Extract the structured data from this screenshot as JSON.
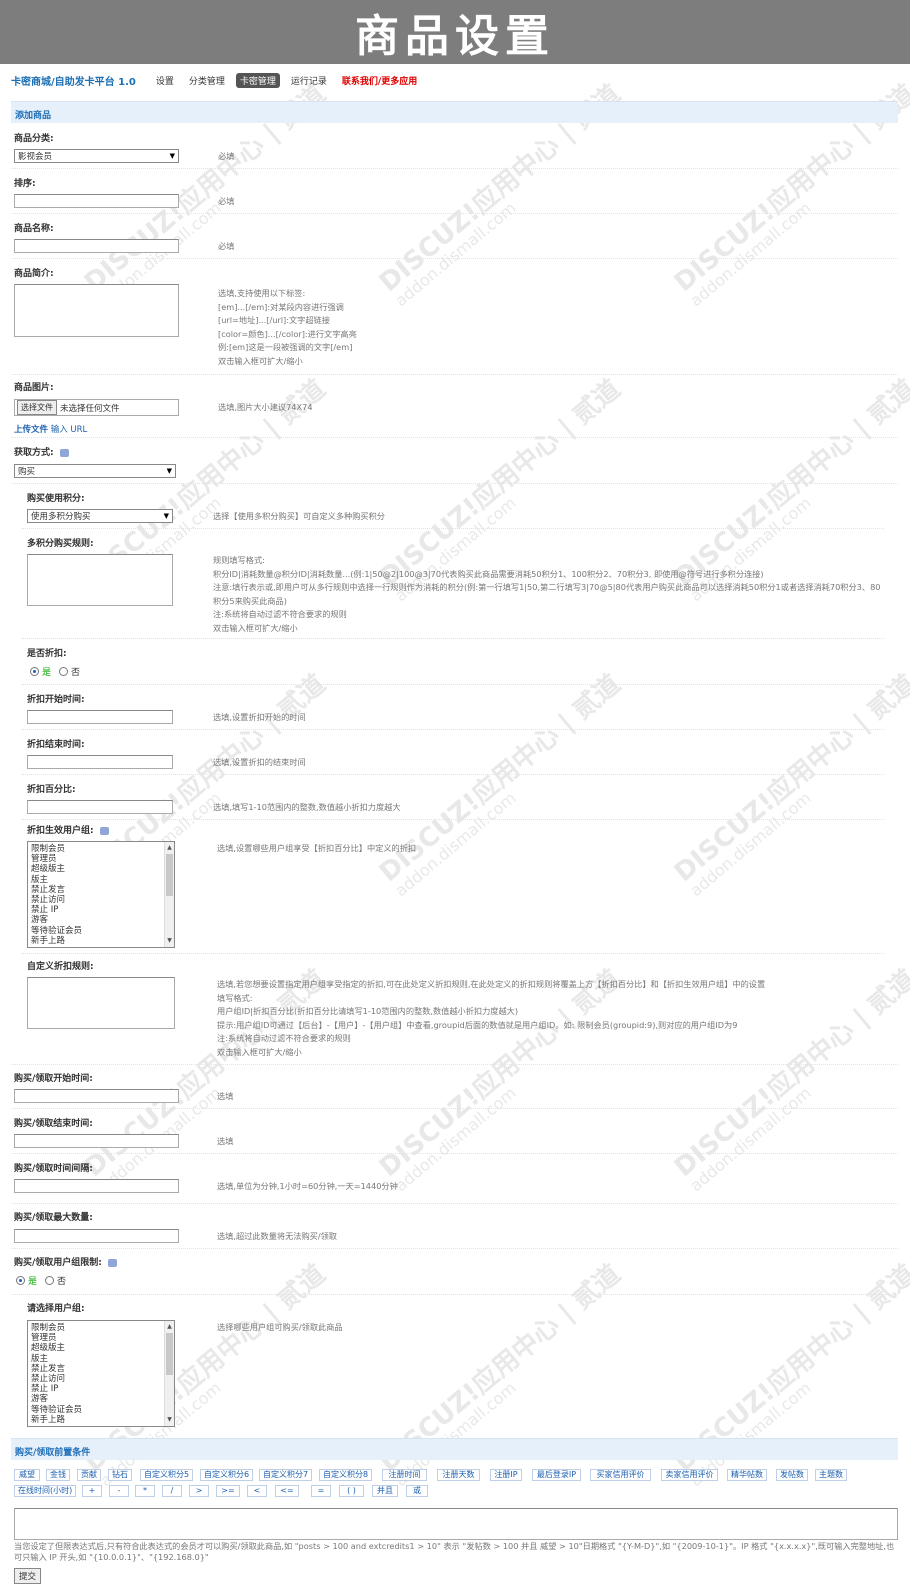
{
  "banner": {
    "title": "商品设置"
  },
  "topnav": {
    "brand": "卡密商城/自助发卡平台 1.0",
    "items": [
      "设置",
      "分类管理",
      "卡密管理",
      "运行记录",
      "联系我们/更多应用"
    ]
  },
  "watermark": {
    "brand": "DISCUZ!应用中心 | 贰道",
    "url": "addon.dismall.com"
  },
  "section_add": "添加商品",
  "category": {
    "label": "商品分类:",
    "value": "影视会员",
    "hint": "必填"
  },
  "sort": {
    "label": "排序:",
    "hint": "必填"
  },
  "name": {
    "label": "商品名称:",
    "hint": "必填"
  },
  "intro": {
    "label": "商品简介:",
    "hints": [
      "选填,支持使用以下标签:",
      "[em]...[/em]:对某段内容进行强调",
      "[url=地址]...[/url]:文字超链接",
      "[color=颜色]...[/color]:进行文字高亮",
      "例:[em]这是一段被强调的文字[/em]",
      "双击输入框可扩大/缩小"
    ]
  },
  "image": {
    "label": "商品图片:",
    "file_button": "选择文件",
    "file_status": "未选择任何文件",
    "upload_link": "上传文件",
    "input_link": "输入 URL",
    "hint": "选填,图片大小建议74X74"
  },
  "acquire": {
    "label": "获取方式:",
    "value": "购买"
  },
  "points": {
    "label": "购买使用积分:",
    "value": "使用多积分购买",
    "hint": "选择【使用多积分购买】可自定义多种购买积分"
  },
  "multi_points": {
    "label": "多积分购买规则:",
    "hints": [
      "规则填写格式:",
      "积分ID|消耗数量@积分ID|消耗数量...(例:1|50@2|100@3|70代表购买此商品需要消耗50积分1、100积分2、70积分3, 即使用@符号进行多积分连接)",
      "注意:填行表示或,即用户可从多行规则中选择一行规则作为消耗的积分(例:第一行填写1|50,第二行填写3|70@5|80代表用户购买此商品可以选择消耗50积分1或者选择消耗70积分3、80积分5来购买此商品)",
      "注:系统将自动过滤不符合要求的规则",
      "双击输入框可扩大/缩小"
    ]
  },
  "discount": {
    "label": "是否折扣:",
    "yes": "是",
    "no": "否"
  },
  "discount_start": {
    "label": "折扣开始时间:",
    "hint": "选填,设置折扣开始的时间"
  },
  "discount_end": {
    "label": "折扣结束时间:",
    "hint": "选填,设置折扣的结束时间"
  },
  "discount_percent": {
    "label": "折扣百分比:",
    "hint": "选填,填写1-10范围内的整数,数值越小折扣力度越大"
  },
  "discount_groups": {
    "label": "折扣生效用户组:",
    "hint": "选填,设置哪些用户组享受【折扣百分比】中定义的折扣"
  },
  "usergroups": [
    "限制会员",
    "管理员",
    "超级版主",
    "版主",
    "禁止发言",
    "禁止访问",
    "禁止 IP",
    "游客",
    "等待验证会员",
    "新手上路"
  ],
  "custom_discount": {
    "label": "自定义折扣规则:",
    "hints": [
      "选填,若您想要设置指定用户组享受指定的折扣,可在此处定义折扣规则,在此处定义的折扣规则将覆盖上方【折扣百分比】和【折扣生效用户组】中的设置",
      "填写格式:",
      "用户组ID|折扣百分比(折扣百分比请填写1-10范围内的整数,数值越小折扣力度越大)",
      "提示:用户组ID可通过【后台】-【用户】-【用户组】中查看,groupid后面的数值就是用户组ID。如: 限制会员(groupid:9),则对应的用户组ID为9",
      "注:系统将自动过滤不符合要求的规则",
      "双击输入框可扩大/缩小"
    ]
  },
  "buy_start": {
    "label": "购买/领取开始时间:",
    "hint": "选填"
  },
  "buy_end": {
    "label": "购买/领取结束时间:",
    "hint": "选填"
  },
  "buy_interval": {
    "label": "购买/领取时间间隔:",
    "hint": "选填,单位为分钟,1小时=60分钟,一天=1440分钟"
  },
  "buy_max": {
    "label": "购买/领取最大数量:",
    "hint": "选填,超过此数量将无法购买/领取"
  },
  "buy_group_limit": {
    "label": "购买/领取用户组限制:",
    "yes": "是",
    "no": "否"
  },
  "select_groups": {
    "label": "请选择用户组:",
    "hint": "选择哪些用户组可购买/领取此商品"
  },
  "section_condition": "购买/领取前置条件",
  "condition_chips_row1": [
    "威望",
    "金钱",
    "贡献",
    "钻石",
    "自定义积分5",
    "自定义积分6",
    "自定义积分7",
    "自定义积分8",
    "注册时间",
    "注册天数",
    "注册IP",
    "最后登录IP",
    "买家信用评价",
    "卖家信用评价",
    "精华帖数",
    "发帖数",
    "主题数"
  ],
  "condition_chips_row2": [
    "在线时间(小时)",
    "+",
    "-",
    "*",
    "/",
    ">",
    ">=",
    "<",
    "<=",
    "=",
    "( )",
    "并且",
    "或"
  ],
  "condition_hint": "当您设定了但限表达式后,只有符合此表达式的会员才可以购买/领取此商品,如 \"posts > 100 and extcredits1 > 10\" 表示 \"发帖数 > 100 并且 威望 > 10\"日期格式 \"{Y-M-D}\",如 \"{2009-10-1}\"。IP 格式 \"{x.x.x.x}\",既可输入完整地址,也可只输入 IP 开头,如 \"{10.0.0.1}\"、\"{192.168.0}\"",
  "submit_label": "提交"
}
